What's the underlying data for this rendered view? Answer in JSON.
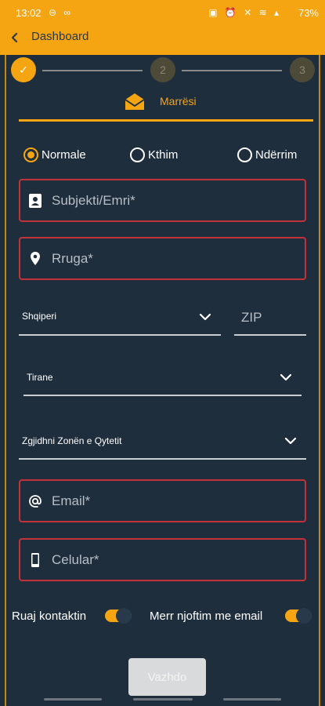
{
  "status_bar": {
    "time": "13:02",
    "left_icons": "⊖ ∞",
    "right_icons": "▣ ⏰ ✕ ≋ ▴",
    "battery": "73%"
  },
  "app_bar": {
    "back_icon": "chevron-left-icon",
    "title": "Dashboard"
  },
  "stepper": {
    "steps": [
      {
        "label": "✓",
        "state": "done"
      },
      {
        "label": "2",
        "state": "pending"
      },
      {
        "label": "3",
        "state": "pending"
      }
    ]
  },
  "section": {
    "icon": "envelope-open-icon",
    "title": "Marrësi"
  },
  "shipment_type": {
    "selected": "Normale",
    "options": [
      "Normale",
      "Kthim",
      "Ndërrim"
    ]
  },
  "fields": {
    "subjekti": {
      "placeholder": "Subjekti/Emri*",
      "icon": "contact-card-icon"
    },
    "rruga": {
      "placeholder": "Rruga*",
      "icon": "location-pin-icon"
    },
    "email": {
      "placeholder": "Email*",
      "icon": "at-sign-icon"
    },
    "celular": {
      "placeholder": "Celular*",
      "icon": "mobile-phone-icon"
    }
  },
  "country": {
    "value": "Shqiperi"
  },
  "zip": {
    "placeholder": "ZIP"
  },
  "city": {
    "value": "Tirane"
  },
  "zone": {
    "value": "Zgjidhni Zonën e Qytetit"
  },
  "toggles": {
    "save_contact": {
      "label": "Ruaj kontaktin",
      "on": true
    },
    "notify_email": {
      "label": "Merr njoftim me email",
      "on": true
    }
  },
  "continue_button": {
    "label": "Vazhdo"
  },
  "colors": {
    "accent": "#f5a512",
    "background": "#1f2e3c",
    "error_border": "#c2323b"
  }
}
